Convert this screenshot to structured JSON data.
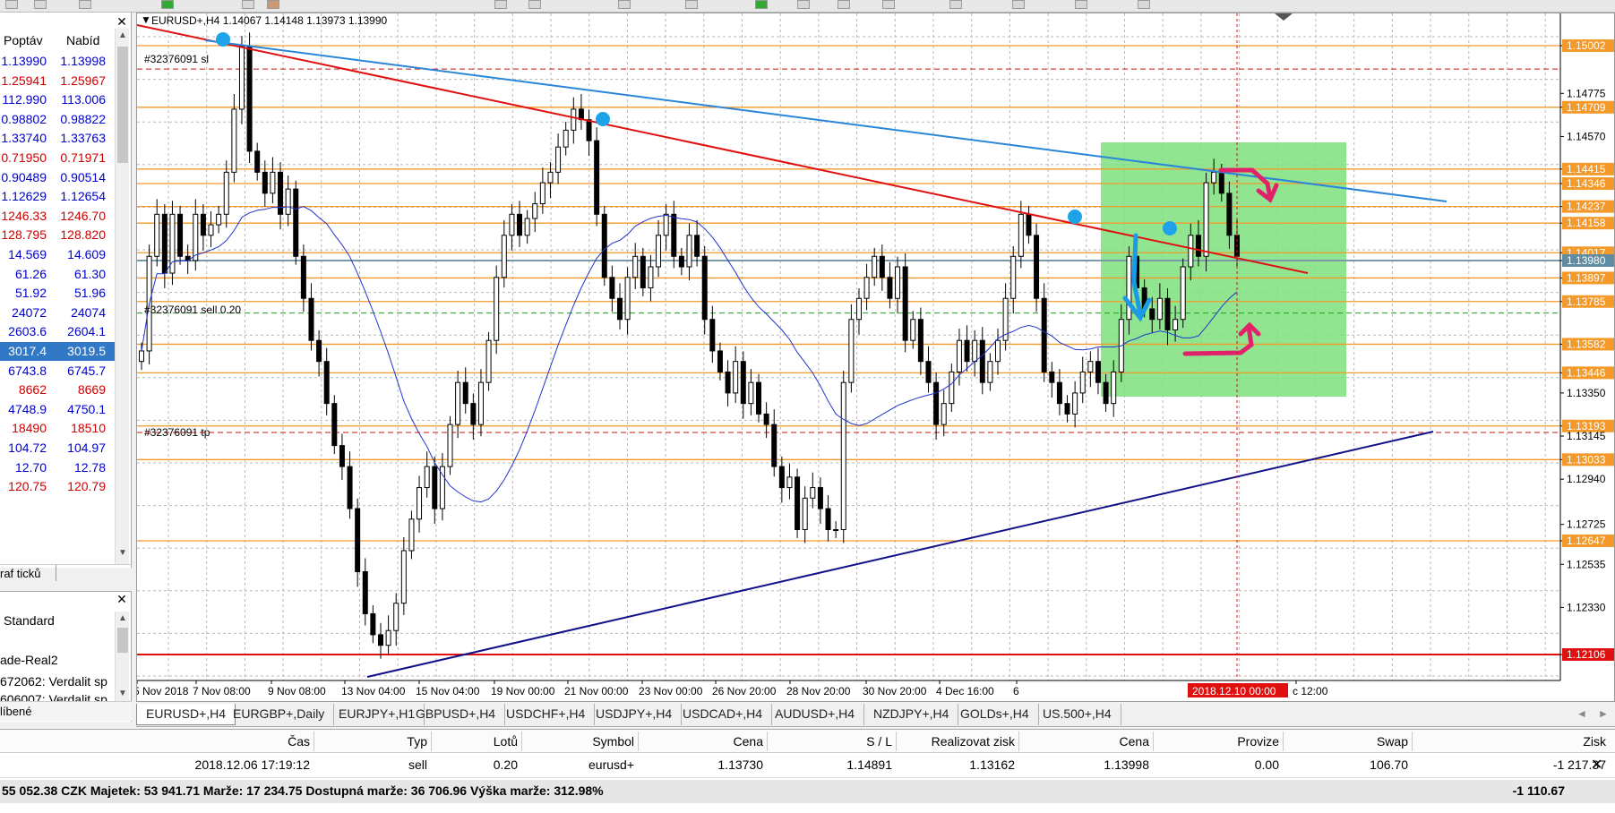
{
  "market_watch": {
    "header": {
      "bid": "Poptáv",
      "ask": "Nabíd"
    },
    "rows": [
      {
        "bid": "1.13990",
        "ask": "1.13998",
        "color": "#0000cc"
      },
      {
        "bid": "1.25941",
        "ask": "1.25967",
        "color": "#cc0000"
      },
      {
        "bid": "112.990",
        "ask": "113.006",
        "color": "#0000cc"
      },
      {
        "bid": "0.98802",
        "ask": "0.98822",
        "color": "#0000cc"
      },
      {
        "bid": "1.33740",
        "ask": "1.33763",
        "color": "#0000cc"
      },
      {
        "bid": "0.71950",
        "ask": "0.71971",
        "color": "#cc0000"
      },
      {
        "bid": "0.90489",
        "ask": "0.90514",
        "color": "#0000cc"
      },
      {
        "bid": "1.12629",
        "ask": "1.12654",
        "color": "#0000cc"
      },
      {
        "bid": "1246.33",
        "ask": "1246.70",
        "color": "#cc0000"
      },
      {
        "bid": "128.795",
        "ask": "128.820",
        "color": "#cc0000"
      },
      {
        "bid": "14.569",
        "ask": "14.609",
        "color": "#0000cc"
      },
      {
        "bid": "61.26",
        "ask": "61.30",
        "color": "#0000cc"
      },
      {
        "bid": "51.92",
        "ask": "51.96",
        "color": "#0000cc"
      },
      {
        "bid": "24072",
        "ask": "24074",
        "color": "#0000cc"
      },
      {
        "bid": "2603.6",
        "ask": "2604.1",
        "color": "#0000cc"
      },
      {
        "bid": "3017.4",
        "ask": "3019.5",
        "color": "#ffffff",
        "selected": true
      },
      {
        "bid": "6743.8",
        "ask": "6745.7",
        "color": "#0000cc"
      },
      {
        "bid": "8662",
        "ask": "8669",
        "color": "#cc0000"
      },
      {
        "bid": "4748.9",
        "ask": "4750.1",
        "color": "#0000cc"
      },
      {
        "bid": "18490",
        "ask": "18510",
        "color": "#cc0000"
      },
      {
        "bid": "104.72",
        "ask": "104.97",
        "color": "#0000cc"
      },
      {
        "bid": "12.70",
        "ask": "12.78",
        "color": "#0000cc"
      },
      {
        "bid": "120.75",
        "ask": "120.79",
        "color": "#cc0000"
      }
    ],
    "tab_label": "raf ticků"
  },
  "navigator": {
    "items": [
      "Standard",
      "ade-Real2",
      "672062: Verdalit sp",
      "606007: Verdalit sp"
    ],
    "tab_label": "líbené"
  },
  "chart": {
    "info": "EURUSD+,H4  1.14067 1.14148 1.13973 1.13990",
    "order_labels": {
      "sl": "#32376091 sl",
      "sell": "#32376091 sell 0.20",
      "tp": "#32376091 tp"
    },
    "price_axis": [
      "1.15002",
      "1.14775",
      "1.14709",
      "1.14570",
      "1.14415",
      "1.14346",
      "1.14237",
      "1.14158",
      "1.14017",
      "1.13980",
      "1.13897",
      "1.13785",
      "1.13582",
      "1.13446",
      "1.13350",
      "1.13193",
      "1.13145",
      "1.13033",
      "1.12940",
      "1.12725",
      "1.12647",
      "1.12535",
      "1.12330",
      "1.12106"
    ],
    "time_axis": [
      "5 Nov 2018",
      "7 Nov 08:00",
      "9 Nov 08:00",
      "13 Nov 04:00",
      "15 Nov 04:00",
      "19 Nov 00:00",
      "21 Nov 00:00",
      "23 Nov 00:00",
      "26 Nov 20:00",
      "28 Nov 20:00",
      "30 Nov 20:00",
      "4 Dec 16:00",
      "6",
      "c 12:00"
    ],
    "time_marker": "2018.12.10 00:00"
  },
  "chart_tabs": [
    "EURUSD+,H4",
    "EURGBP+,Daily",
    "EURJPY+,H1",
    "GBPUSD+,H4",
    "USDCHF+,H4",
    "USDJPY+,H4",
    "USDCAD+,H4",
    "AUDUSD+,H4",
    "NZDJPY+,H4",
    "GOLDs+,H4",
    "US.500+,H4"
  ],
  "terminal": {
    "headers": [
      "Čas",
      "Typ",
      "Lotů",
      "Symbol",
      "Cena",
      "S / L",
      "Realizovat zisk",
      "Cena",
      "Provize",
      "Swap",
      "Zisk"
    ],
    "row": [
      "2018.12.06 17:19:12",
      "sell",
      "0.20",
      "eurusd+",
      "1.13730",
      "1.14891",
      "1.13162",
      "1.13998",
      "0.00",
      "106.70",
      "-1 217.37"
    ],
    "balance": "55 052.38 CZK  Majetek: 53 941.71  Marže: 17 234.75  Dostupná marže: 36 706.96  Výška marže: 312.98%",
    "total_profit": "-1 110.67"
  }
}
